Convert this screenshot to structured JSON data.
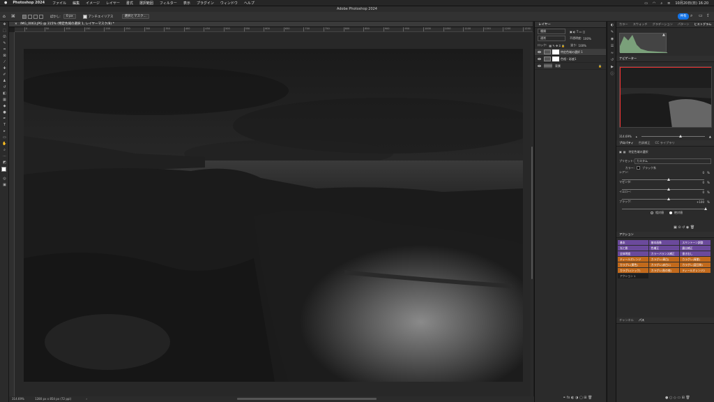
{
  "menubar": {
    "app": "Photoshop 2024",
    "items": [
      "ファイル",
      "編集",
      "イメージ",
      "レイヤー",
      "書式",
      "選択範囲",
      "フィルター",
      "表示",
      "プラグイン",
      "ウィンドウ",
      "ヘルプ"
    ],
    "clock": "10月20日(日) 16:20"
  },
  "window": {
    "title": "Adobe Photoshop 2024"
  },
  "options": {
    "feather_label": "ぼかし:",
    "feather_value": "0 px",
    "antialias": "アンチエイリアス",
    "select_mask": "選択とマスク..."
  },
  "share_label": "共有",
  "document": {
    "tab": "IMG_0063.JPG @ 315% (特定色域の選択 1, レイヤーマスク/8) *"
  },
  "ruler": {
    "ticks": [
      "0",
      "50",
      "100",
      "150",
      "200",
      "250",
      "300",
      "350",
      "400",
      "450",
      "500",
      "550",
      "600",
      "650",
      "700",
      "750",
      "800",
      "850",
      "900",
      "950",
      "1000",
      "1050",
      "1100",
      "1150",
      "1200",
      "1250"
    ]
  },
  "status": {
    "zoom": "314.69%",
    "info": "1280 px x 854 px (72 ppi)"
  },
  "layers": {
    "tab": "レイヤー",
    "kind": "種類",
    "blend": "通常",
    "opacity_label": "不透明度:",
    "opacity": "100%",
    "lock_label": "ロック:",
    "fill_label": "塗り:",
    "fill": "100%",
    "rows": [
      {
        "name": "特定色域の選択 1"
      },
      {
        "name": "色相・彩度1"
      },
      {
        "name": "背景"
      }
    ]
  },
  "right": {
    "top_tabs": [
      "カラー",
      "スウォッチ",
      "グラデーション",
      "パターン",
      "ヒストグラム"
    ],
    "navigator_tab": "ナビゲーター",
    "nav_zoom": "314.69%",
    "props_tabs": [
      "プロパティ",
      "色調補正",
      "CC ライブラリ"
    ],
    "props_title": "特定色域の選択",
    "preset_label": "プリセット:",
    "preset_value": "カスタム",
    "color_label": "カラー:",
    "color_value": "ブラック系",
    "sliders": [
      {
        "label": "シアン:",
        "value": "0",
        "unit": "%"
      },
      {
        "label": "マゼンタ:",
        "value": "0",
        "unit": "%"
      },
      {
        "label": "イエロー:",
        "value": "0",
        "unit": "%"
      },
      {
        "label": "ブラック:",
        "value": "+100",
        "unit": "%"
      }
    ],
    "relative": "相対値",
    "absolute": "絶対値",
    "actions_tab": "アクション",
    "actions": [
      [
        "基本",
        "基本画像",
        "スキントーン調整"
      ],
      [
        "光と影",
        "色補正",
        "露出補正"
      ],
      [
        "全体明度",
        "カラーバランス補正",
        "書き出し"
      ],
      [
        "ティールオレンジ",
        "カラグレ(青白)",
        "カラグレ(青紫)"
      ],
      [
        "カラグレ(黄色)",
        "カラグレ(赤白1)",
        "カラグレ(夏日和)"
      ],
      [
        "カラグレ(シック)",
        "カラグレ(秋の夜)",
        "ティールオレンジ2"
      ]
    ],
    "action_set": "アクション 1",
    "bottom_tabs": [
      "チャンネル",
      "パス"
    ]
  }
}
